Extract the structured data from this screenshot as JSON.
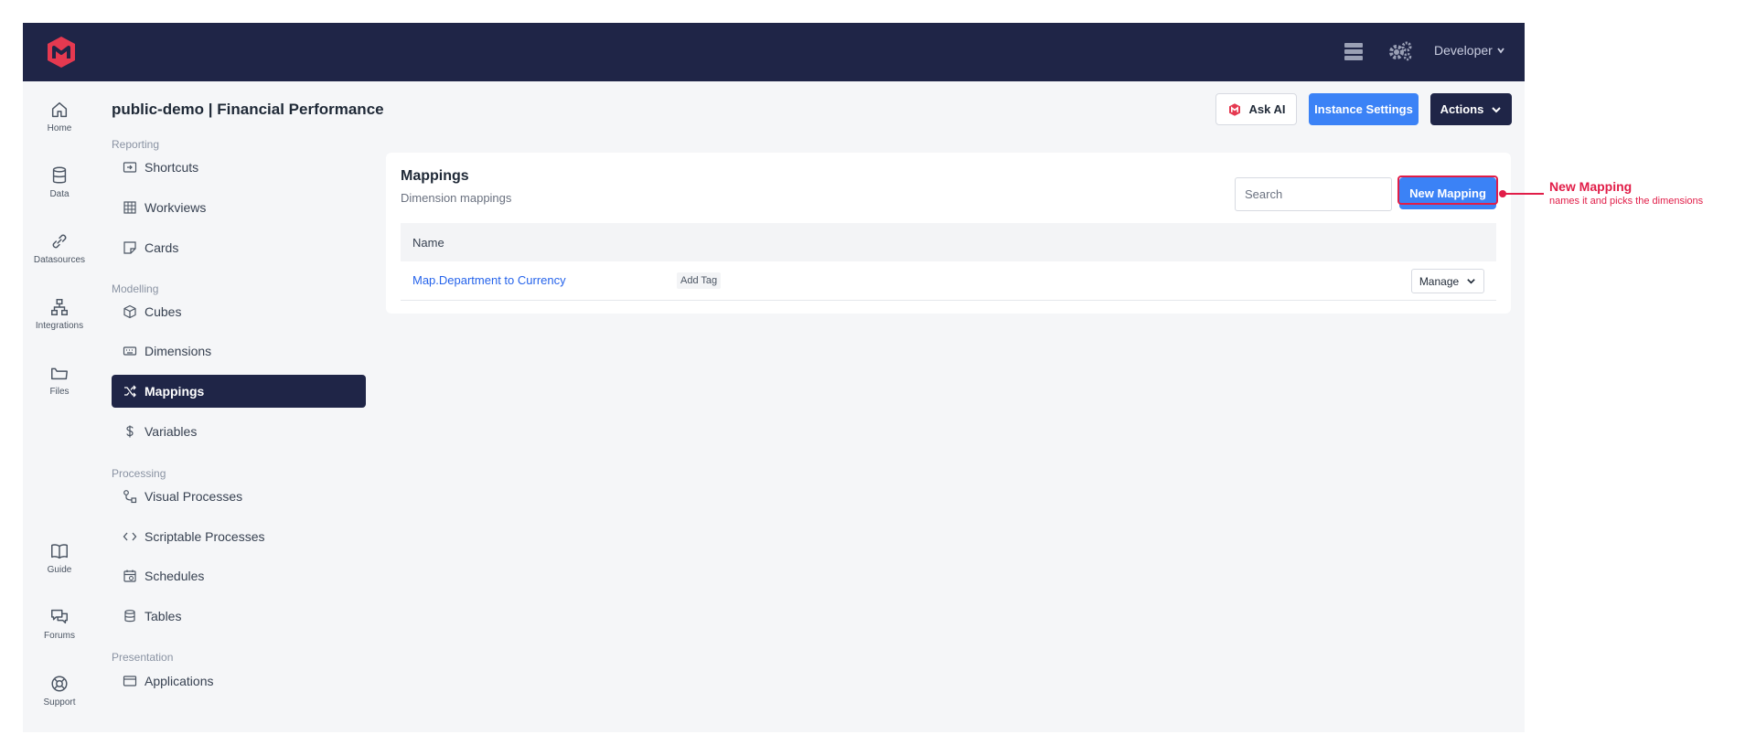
{
  "topbar": {
    "user_menu": "Developer"
  },
  "rail": [
    {
      "label": "Home",
      "icon": "home-icon"
    },
    {
      "label": "Data",
      "icon": "database-icon"
    },
    {
      "label": "Datasources",
      "icon": "link-icon"
    },
    {
      "label": "Integrations",
      "icon": "network-icon"
    },
    {
      "label": "Files",
      "icon": "folder-icon"
    },
    {
      "label": "Guide",
      "icon": "book-icon"
    },
    {
      "label": "Forums",
      "icon": "chat-icon"
    },
    {
      "label": "Support",
      "icon": "lifebuoy-icon"
    }
  ],
  "header": {
    "title": "public-demo | Financial Performance",
    "ask_ai": "Ask AI",
    "instance_settings": "Instance Settings",
    "actions": "Actions"
  },
  "sidebar": {
    "sections": [
      "Reporting",
      "Modelling",
      "Processing",
      "Presentation"
    ],
    "items": [
      {
        "label": "Shortcuts",
        "icon": "shortcut-icon"
      },
      {
        "label": "Workviews",
        "icon": "grid-icon"
      },
      {
        "label": "Cards",
        "icon": "card-icon"
      },
      {
        "label": "Cubes",
        "icon": "cube-icon"
      },
      {
        "label": "Dimensions",
        "icon": "keyboard-icon"
      },
      {
        "label": "Mappings",
        "icon": "shuffle-icon"
      },
      {
        "label": "Variables",
        "icon": "dollar-icon"
      },
      {
        "label": "Visual Processes",
        "icon": "flow-icon"
      },
      {
        "label": "Scriptable Processes",
        "icon": "code-icon"
      },
      {
        "label": "Schedules",
        "icon": "calendar-icon"
      },
      {
        "label": "Tables",
        "icon": "table-icon"
      },
      {
        "label": "Applications",
        "icon": "window-icon"
      }
    ]
  },
  "main": {
    "title": "Mappings",
    "subtitle": "Dimension mappings",
    "search_placeholder": "Search",
    "new_button": "New Mapping",
    "table": {
      "header": "Name",
      "rows": [
        {
          "name": "Map.Department to Currency",
          "tag": "Add Tag",
          "manage": "Manage"
        }
      ]
    }
  },
  "annotation": {
    "title": "New Mapping",
    "text": "names it and picks the dimensions",
    "color": "#e11d48"
  },
  "colors": {
    "navy": "#1f2547",
    "blue": "#3b82f6",
    "accent": "#e11d48"
  }
}
